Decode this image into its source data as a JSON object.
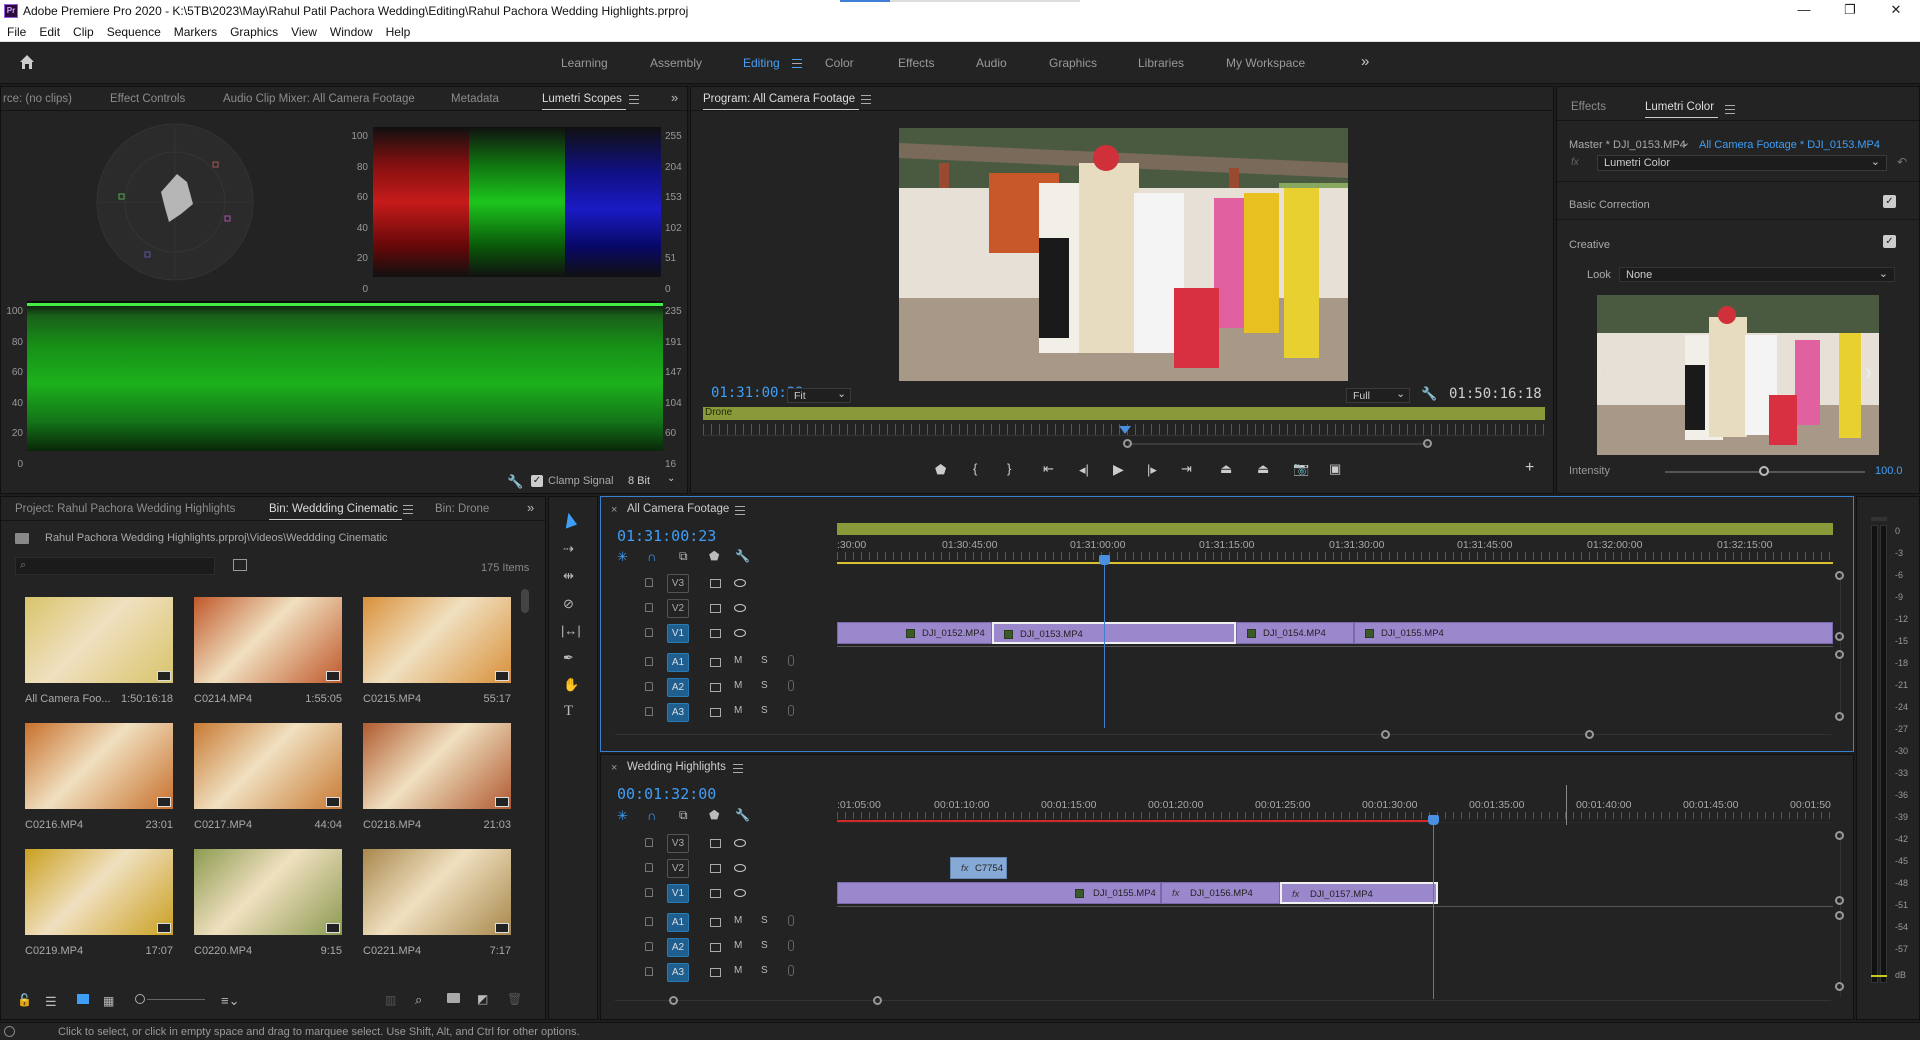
{
  "titlebar": {
    "app_icon": "Pr",
    "title": "Adobe Premiere Pro 2020 - K:\\5TB\\2023\\May\\Rahul Patil Pachora Wedding\\Editing\\Rahul Pachora Wedding Highlights.prproj",
    "minimize": "—",
    "maximize": "❐",
    "close": "✕"
  },
  "menu": [
    "File",
    "Edit",
    "Clip",
    "Sequence",
    "Markers",
    "Graphics",
    "View",
    "Window",
    "Help"
  ],
  "workspaces": {
    "tabs": [
      "Learning",
      "Assembly",
      "Editing",
      "Color",
      "Effects",
      "Audio",
      "Graphics",
      "Libraries",
      "My Workspace"
    ],
    "active": "Editing",
    "overflow": "»"
  },
  "scopes_panel": {
    "tabs": [
      "rce: (no clips)",
      "Effect Controls",
      "Audio Clip Mixer: All Camera Footage",
      "Metadata",
      "Lumetri Scopes"
    ],
    "active": "Lumetri Scopes",
    "parade_left": [
      "100",
      "80",
      "60",
      "40",
      "20",
      "0"
    ],
    "parade_right": [
      "255",
      "204",
      "153",
      "102",
      "51",
      "0"
    ],
    "wave_left": [
      "100",
      "80",
      "60",
      "40",
      "20",
      "0"
    ],
    "wave_right": [
      "235",
      "191",
      "147",
      "104",
      "60",
      "16"
    ],
    "clamp_label": "Clamp Signal",
    "bit_depth": "8 Bit"
  },
  "program": {
    "title": "Program: All Camera Footage",
    "timecode": "01:31:00:23",
    "zoom": "Fit",
    "resolution": "Full",
    "duration": "01:50:16:18",
    "bar_label": "Drone"
  },
  "lumetri": {
    "tabs": [
      "Effects",
      "Lumetri Color"
    ],
    "active": "Lumetri Color",
    "master": "Master * DJI_0153.MP4",
    "target": "All Camera Footage * DJI_0153.MP4",
    "effect": "Lumetri Color",
    "basic": "Basic Correction",
    "creative": "Creative",
    "look_label": "Look",
    "look_value": "None",
    "intensity_label": "Intensity",
    "intensity_value": "100.0"
  },
  "project": {
    "tabs": [
      "Project: Rahul Pachora Wedding Highlights",
      "Bin: Weddding Cinematic",
      "Bin: Drone"
    ],
    "active": "Bin: Weddding Cinematic",
    "path": "Rahul Pachora Wedding Highlights.prproj\\Videos\\Weddding Cinematic",
    "count": "175 Items",
    "items": [
      {
        "name": "All Camera Foo...",
        "dur": "1:50:16:18",
        "bg": "#d8c46a"
      },
      {
        "name": "C0214.MP4",
        "dur": "1:55:05",
        "bg": "#c0582a"
      },
      {
        "name": "C0215.MP4",
        "dur": "55:17",
        "bg": "#d8903a"
      },
      {
        "name": "C0216.MP4",
        "dur": "23:01",
        "bg": "#c8702c"
      },
      {
        "name": "C0217.MP4",
        "dur": "44:04",
        "bg": "#c87a34"
      },
      {
        "name": "C0218.MP4",
        "dur": "21:03",
        "bg": "#b05a30"
      },
      {
        "name": "C0219.MP4",
        "dur": "17:07",
        "bg": "#caa020"
      },
      {
        "name": "C0220.MP4",
        "dur": "9:15",
        "bg": "#8c9a50"
      },
      {
        "name": "C0221.MP4",
        "dur": "7:17",
        "bg": "#a8884c"
      }
    ]
  },
  "seq1": {
    "title": "All Camera Footage",
    "timecode": "01:31:00:23",
    "ruler": [
      ":30:00",
      "01:30:45:00",
      "01:31:00:00",
      "01:31:15:00",
      "01:31:30:00",
      "01:31:45:00",
      "01:32:00:00",
      "01:32:15:00"
    ],
    "tracks": [
      "V3",
      "V2",
      "V1",
      "A1",
      "A2",
      "A3"
    ],
    "clips": [
      "DJI_0152.MP4",
      "DJI_0153.MP4",
      "DJI_0154.MP4",
      "DJI_0155.MP4"
    ]
  },
  "seq2": {
    "title": "Wedding Highlights",
    "timecode": "00:01:32:00",
    "ruler": [
      ":01:05:00",
      "00:01:10:00",
      "00:01:15:00",
      "00:01:20:00",
      "00:01:25:00",
      "00:01:30:00",
      "00:01:35:00",
      "00:01:40:00",
      "00:01:45:00",
      "00:01:50"
    ],
    "tracks": [
      "V3",
      "V2",
      "V1",
      "A1",
      "A2",
      "A3"
    ],
    "clips": [
      "C7754",
      "DJI_0155.MP4",
      "DJI_0156.MP4",
      "DJI_0157.MP4"
    ]
  },
  "meter": [
    "0",
    "-3",
    "-6",
    "-9",
    "-12",
    "-15",
    "-18",
    "-21",
    "-24",
    "-27",
    "-30",
    "-33",
    "-36",
    "-39",
    "-42",
    "-45",
    "-48",
    "-51",
    "-54",
    "-57",
    "dB"
  ],
  "status": "Click to select, or click in empty space and drag to marquee select. Use Shift, Alt, and Ctrl for other options.",
  "colors": {
    "accent": "#3f9ff7",
    "clip": "#9b88cc",
    "workarea": "#8a9a3a"
  }
}
